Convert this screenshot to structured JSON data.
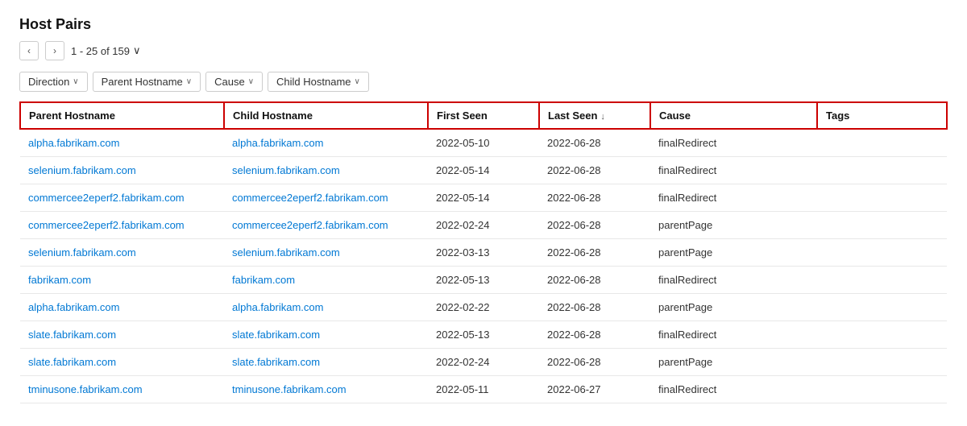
{
  "page": {
    "title": "Host Pairs",
    "pagination": {
      "prev_label": "‹",
      "next_label": "›",
      "info": "1 - 25 of 159",
      "chevron": "∨"
    },
    "filters": [
      {
        "label": "Direction",
        "id": "filter-direction"
      },
      {
        "label": "Parent Hostname",
        "id": "filter-parent"
      },
      {
        "label": "Cause",
        "id": "filter-cause"
      },
      {
        "label": "Child Hostname",
        "id": "filter-child"
      }
    ],
    "table": {
      "columns": [
        {
          "id": "parent",
          "label": "Parent Hostname",
          "sortable": false
        },
        {
          "id": "child",
          "label": "Child Hostname",
          "sortable": false
        },
        {
          "id": "firstSeen",
          "label": "First Seen",
          "sortable": false
        },
        {
          "id": "lastSeen",
          "label": "Last Seen",
          "sortable": true,
          "sort_icon": "↓"
        },
        {
          "id": "cause",
          "label": "Cause",
          "sortable": false
        },
        {
          "id": "tags",
          "label": "Tags",
          "sortable": false
        }
      ],
      "rows": [
        {
          "parent": "alpha.fabrikam.com",
          "child": "alpha.fabrikam.com",
          "firstSeen": "2022-05-10",
          "lastSeen": "2022-06-28",
          "cause": "finalRedirect",
          "tags": ""
        },
        {
          "parent": "selenium.fabrikam.com",
          "child": "selenium.fabrikam.com",
          "firstSeen": "2022-05-14",
          "lastSeen": "2022-06-28",
          "cause": "finalRedirect",
          "tags": ""
        },
        {
          "parent": "commercee2eperf2.fabrikam.com",
          "child": "commercee2eperf2.fabrikam.com",
          "firstSeen": "2022-05-14",
          "lastSeen": "2022-06-28",
          "cause": "finalRedirect",
          "tags": ""
        },
        {
          "parent": "commercee2eperf2.fabrikam.com",
          "child": "commercee2eperf2.fabrikam.com",
          "firstSeen": "2022-02-24",
          "lastSeen": "2022-06-28",
          "cause": "parentPage",
          "tags": ""
        },
        {
          "parent": "selenium.fabrikam.com",
          "child": "selenium.fabrikam.com",
          "firstSeen": "2022-03-13",
          "lastSeen": "2022-06-28",
          "cause": "parentPage",
          "tags": ""
        },
        {
          "parent": "fabrikam.com",
          "child": "fabrikam.com",
          "firstSeen": "2022-05-13",
          "lastSeen": "2022-06-28",
          "cause": "finalRedirect",
          "tags": ""
        },
        {
          "parent": "alpha.fabrikam.com",
          "child": "alpha.fabrikam.com",
          "firstSeen": "2022-02-22",
          "lastSeen": "2022-06-28",
          "cause": "parentPage",
          "tags": ""
        },
        {
          "parent": "slate.fabrikam.com",
          "child": "slate.fabrikam.com",
          "firstSeen": "2022-05-13",
          "lastSeen": "2022-06-28",
          "cause": "finalRedirect",
          "tags": ""
        },
        {
          "parent": "slate.fabrikam.com",
          "child": "slate.fabrikam.com",
          "firstSeen": "2022-02-24",
          "lastSeen": "2022-06-28",
          "cause": "parentPage",
          "tags": ""
        },
        {
          "parent": "tminusone.fabrikam.com",
          "child": "tminusone.fabrikam.com",
          "firstSeen": "2022-05-11",
          "lastSeen": "2022-06-27",
          "cause": "finalRedirect",
          "tags": ""
        }
      ]
    }
  }
}
